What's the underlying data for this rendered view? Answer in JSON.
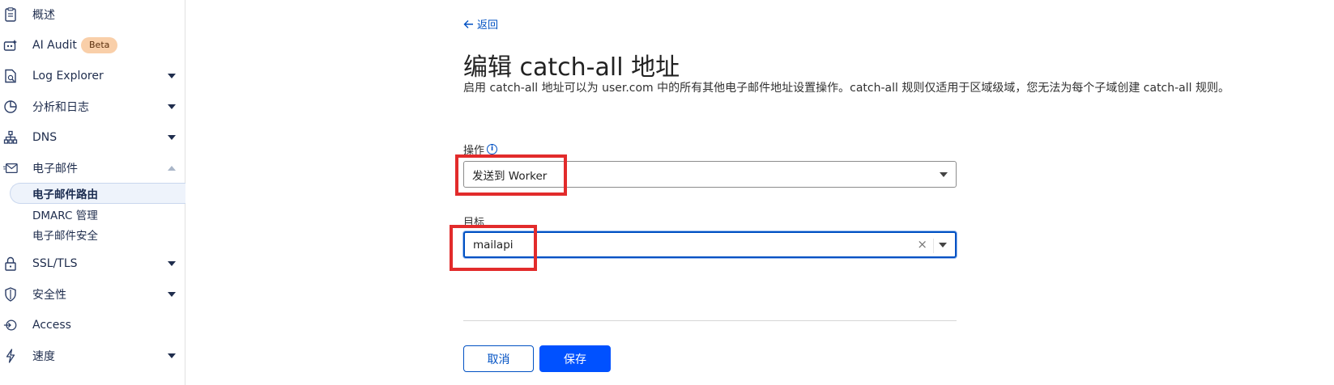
{
  "sidebar": {
    "items": [
      {
        "label": "概述",
        "icon": "clipboard-icon"
      },
      {
        "label": "AI Audit",
        "icon": "ai-audit-icon",
        "badge": "Beta"
      },
      {
        "label": "Log Explorer",
        "icon": "log-explorer-icon"
      },
      {
        "label": "分析和日志",
        "icon": "analytics-icon"
      },
      {
        "label": "DNS",
        "icon": "dns-icon"
      },
      {
        "label": "电子邮件",
        "icon": "email-icon"
      },
      {
        "label": "SSL/TLS",
        "icon": "lock-icon"
      },
      {
        "label": "安全性",
        "icon": "shield-icon"
      },
      {
        "label": "Access",
        "icon": "access-icon"
      },
      {
        "label": "速度",
        "icon": "lightning-icon"
      }
    ],
    "email_sub": [
      {
        "label": "电子邮件路由",
        "active": true
      },
      {
        "label": "DMARC 管理"
      },
      {
        "label": "电子邮件安全"
      }
    ]
  },
  "main": {
    "back_label": "返回",
    "title": "编辑 catch-all 地址",
    "description": "启用 catch-all 地址可以为 user.com 中的所有其他电子邮件地址设置操作。catch-all 规则仅适用于区域级域，您无法为每个子域创建 catch-all 规则。",
    "action_label": "操作",
    "action_value": "发送到 Worker",
    "target_label": "目标",
    "target_value": "mailapi",
    "cancel_label": "取消",
    "save_label": "保存"
  },
  "colors": {
    "accent": "#0051c3",
    "primary_button": "#0051ff",
    "highlight": "#e22b2b",
    "beta_badge": "#f9cfa9"
  }
}
